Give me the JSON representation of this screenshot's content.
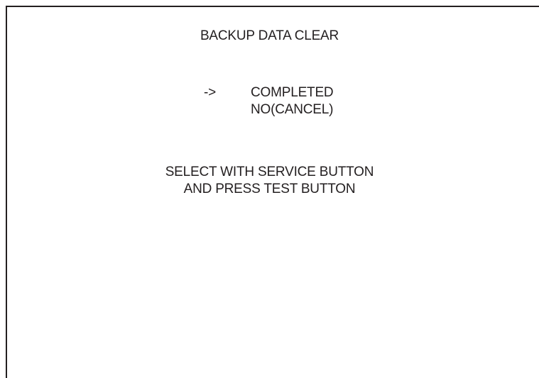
{
  "screen": {
    "title": "BACKUP DATA CLEAR",
    "cursor": "->",
    "options": [
      {
        "label": "COMPLETED",
        "selected": true
      },
      {
        "label": "NO(CANCEL)",
        "selected": false
      }
    ],
    "instructions": [
      "SELECT WITH SERVICE BUTTON",
      "AND PRESS TEST BUTTON"
    ]
  },
  "colors": {
    "background": "#ffffff",
    "text": "#231f20",
    "border": "#231f20"
  }
}
